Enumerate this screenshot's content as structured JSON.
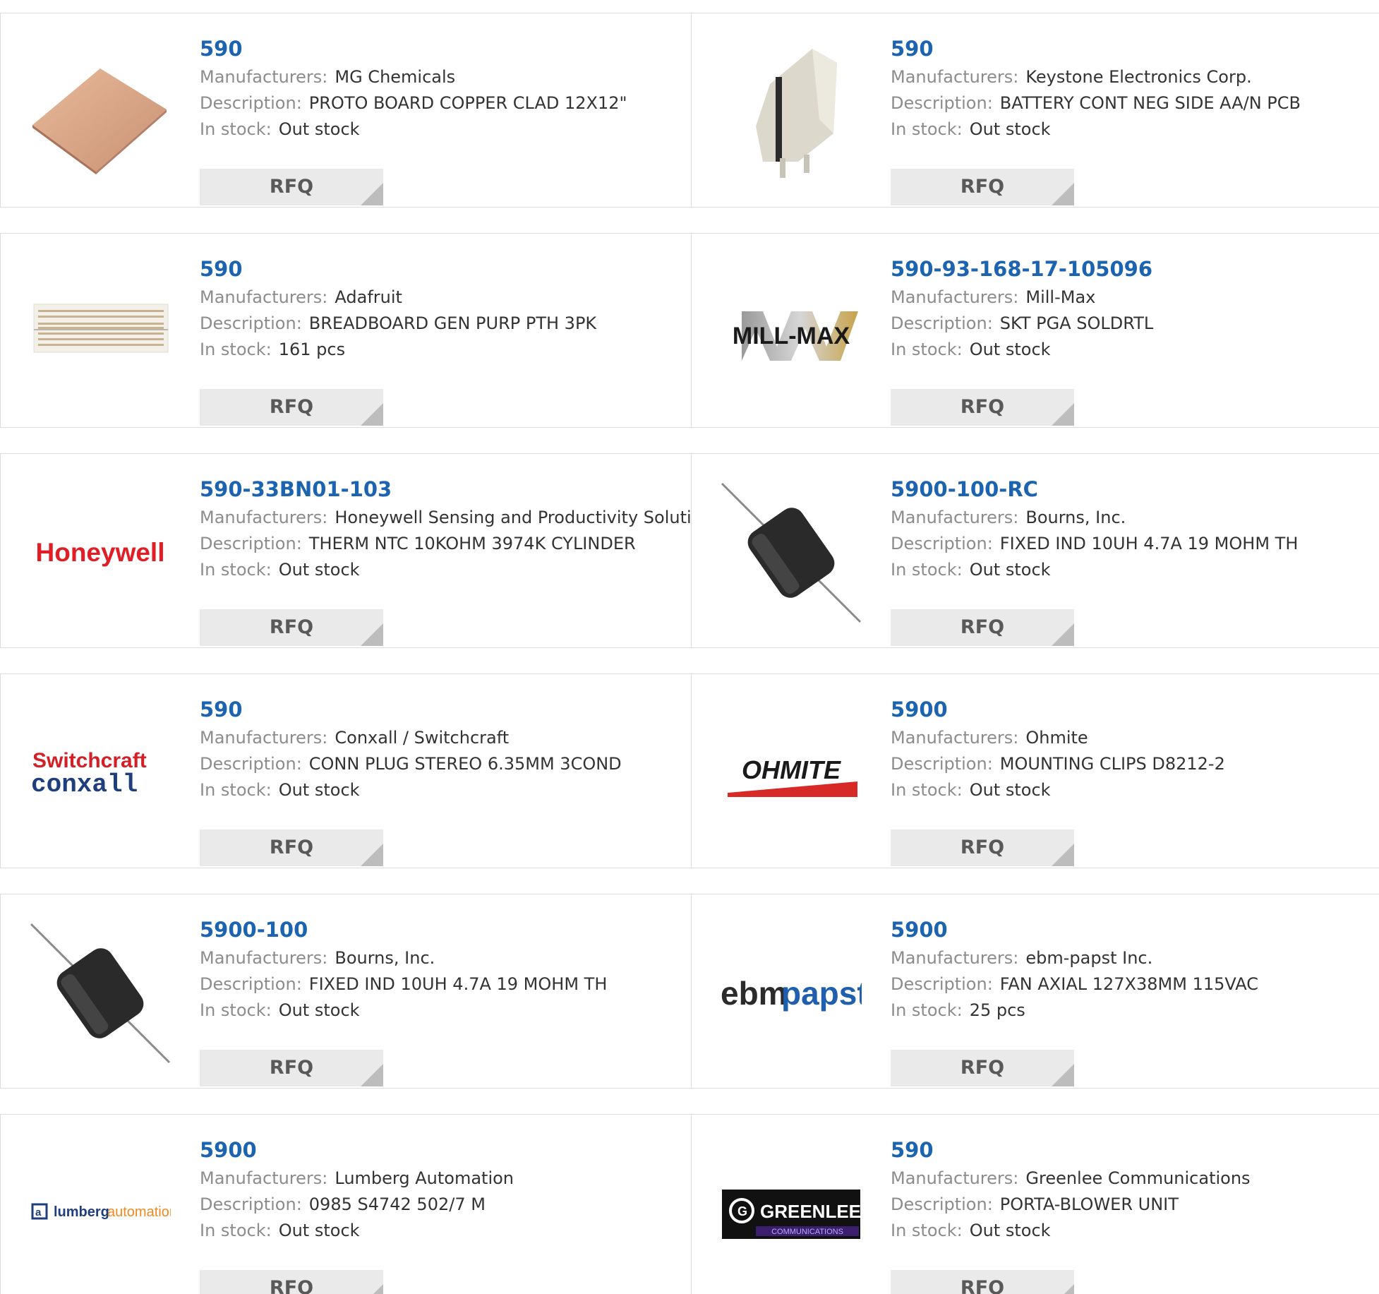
{
  "labels": {
    "manufacturers": "Manufacturers:",
    "description": "Description:",
    "in_stock": "In stock:",
    "rfq": "RFQ"
  },
  "products": [
    {
      "part": "590",
      "manufacturer": "MG Chemicals",
      "description": "PROTO BOARD COPPER CLAD 12X12\"",
      "stock": "Out stock",
      "image": "copper-board-image"
    },
    {
      "part": "590",
      "manufacturer": "Keystone Electronics Corp.",
      "description": "BATTERY CONT NEG SIDE AA/N PCB",
      "stock": "Out stock",
      "image": "battery-contact-image"
    },
    {
      "part": "590",
      "manufacturer": "Adafruit",
      "description": "BREADBOARD GEN PURP PTH 3PK",
      "stock": "161 pcs",
      "image": "breadboard-image"
    },
    {
      "part": "590-93-168-17-105096",
      "manufacturer": "Mill-Max",
      "description": "SKT PGA SOLDRTL",
      "stock": "Out stock",
      "image": "mill-max-logo",
      "logo_text": "MILL-MAX"
    },
    {
      "part": "590-33BN01-103",
      "manufacturer": "Honeywell Sensing and Productivity Solutions",
      "description": "THERM NTC 10KOHM 3974K CYLINDER",
      "stock": "Out stock",
      "image": "honeywell-logo",
      "logo_text": "Honeywell"
    },
    {
      "part": "5900-100-RC",
      "manufacturer": "Bourns, Inc.",
      "description": "FIXED IND 10UH 4.7A 19 MOHM TH",
      "stock": "Out stock",
      "image": "inductor-image"
    },
    {
      "part": "590",
      "manufacturer": "Conxall / Switchcraft",
      "description": "CONN PLUG STEREO 6.35MM 3COND",
      "stock": "Out stock",
      "image": "switchcraft-conxall-logo",
      "logo_text": "Switchcraft",
      "logo_text2": "conxall"
    },
    {
      "part": "5900",
      "manufacturer": "Ohmite",
      "description": "MOUNTING CLIPS D8212-2",
      "stock": "Out stock",
      "image": "ohmite-logo",
      "logo_text": "OHMITE"
    },
    {
      "part": "5900-100",
      "manufacturer": "Bourns, Inc.",
      "description": "FIXED IND 10UH 4.7A 19 MOHM TH",
      "stock": "Out stock",
      "image": "inductor-image"
    },
    {
      "part": "5900",
      "manufacturer": "ebm-papst Inc.",
      "description": "FAN AXIAL 127X38MM 115VAC",
      "stock": "25 pcs",
      "image": "ebmpapst-logo",
      "logo_text": "ebm",
      "logo_text2": "papst"
    },
    {
      "part": "5900",
      "manufacturer": "Lumberg Automation",
      "description": "0985 S4742 502/7 M",
      "stock": "Out stock",
      "image": "lumberg-automation-logo",
      "logo_text": "lumberg",
      "logo_text2": "automation"
    },
    {
      "part": "590",
      "manufacturer": "Greenlee Communications",
      "description": "PORTA-BLOWER UNIT",
      "stock": "Out stock",
      "image": "greenlee-logo",
      "logo_text": "GREENLEE",
      "logo_text2": "COMMUNICATIONS"
    }
  ],
  "colors": {
    "link": "#1d64b0",
    "label": "#8c8c8c",
    "value": "#333333",
    "rfq_bg": "#eaeaea",
    "border": "#dcdcdc"
  }
}
